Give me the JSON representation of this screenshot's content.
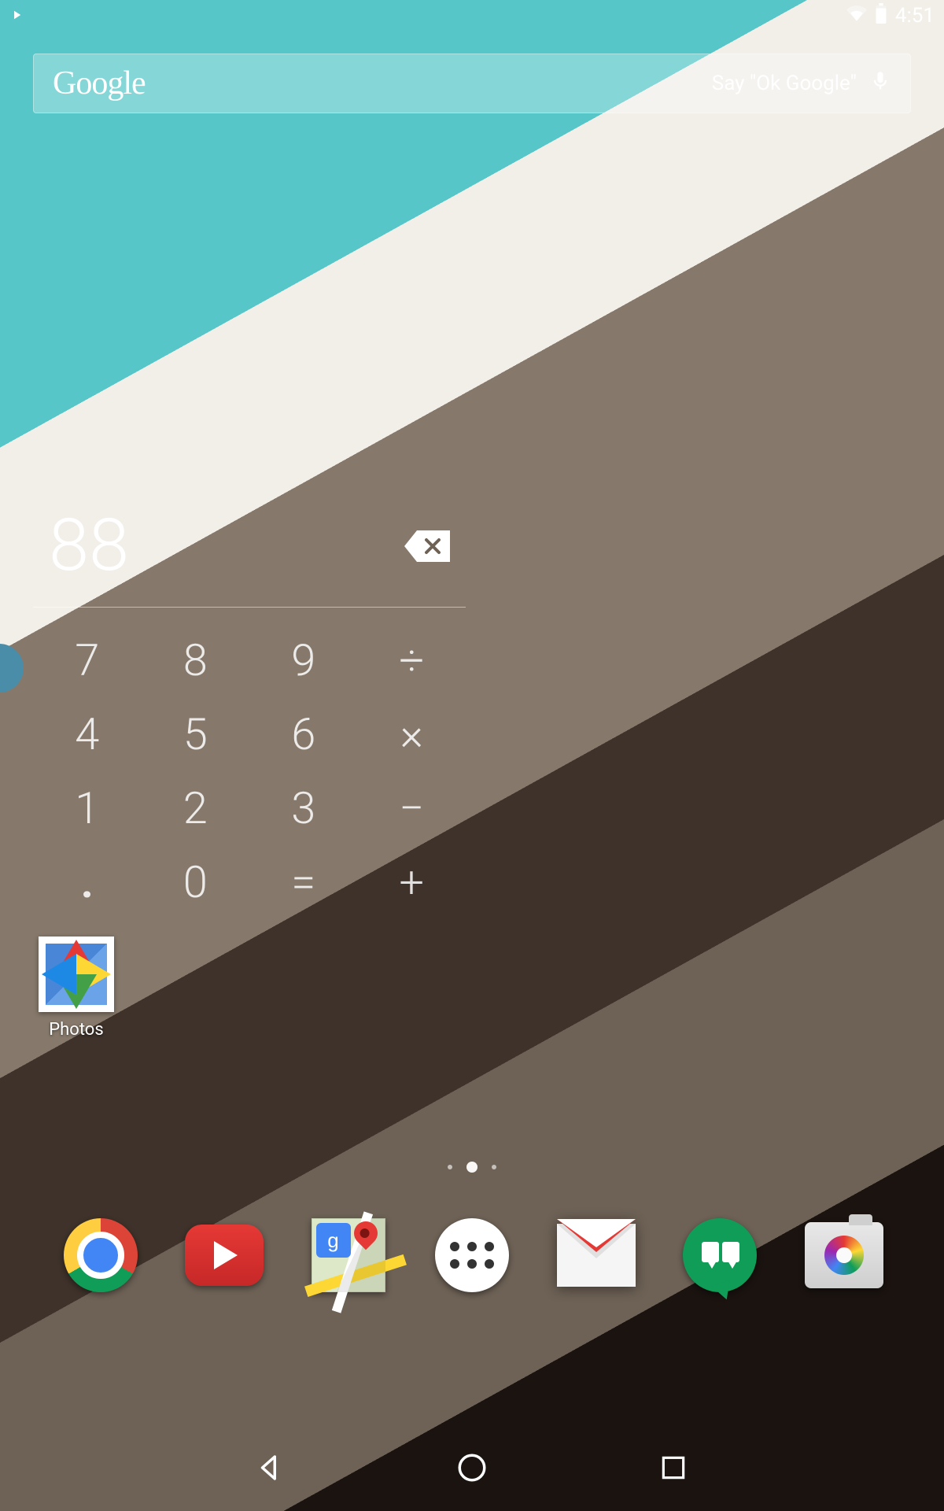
{
  "status_bar": {
    "time": "4:51"
  },
  "search": {
    "logo": "Google",
    "prompt": "Say \"Ok Google\""
  },
  "calculator": {
    "display": "88",
    "keys": {
      "r0c0": "7",
      "r0c1": "8",
      "r0c2": "9",
      "r0c3": "÷",
      "r1c0": "4",
      "r1c1": "5",
      "r1c2": "6",
      "r1c3": "×",
      "r2c0": "1",
      "r2c1": "2",
      "r2c2": "3",
      "r2c3": "−",
      "r3c0": ".",
      "r3c1": "0",
      "r3c2": "=",
      "r3c3": "+"
    }
  },
  "apps": {
    "photos_label": "Photos"
  }
}
